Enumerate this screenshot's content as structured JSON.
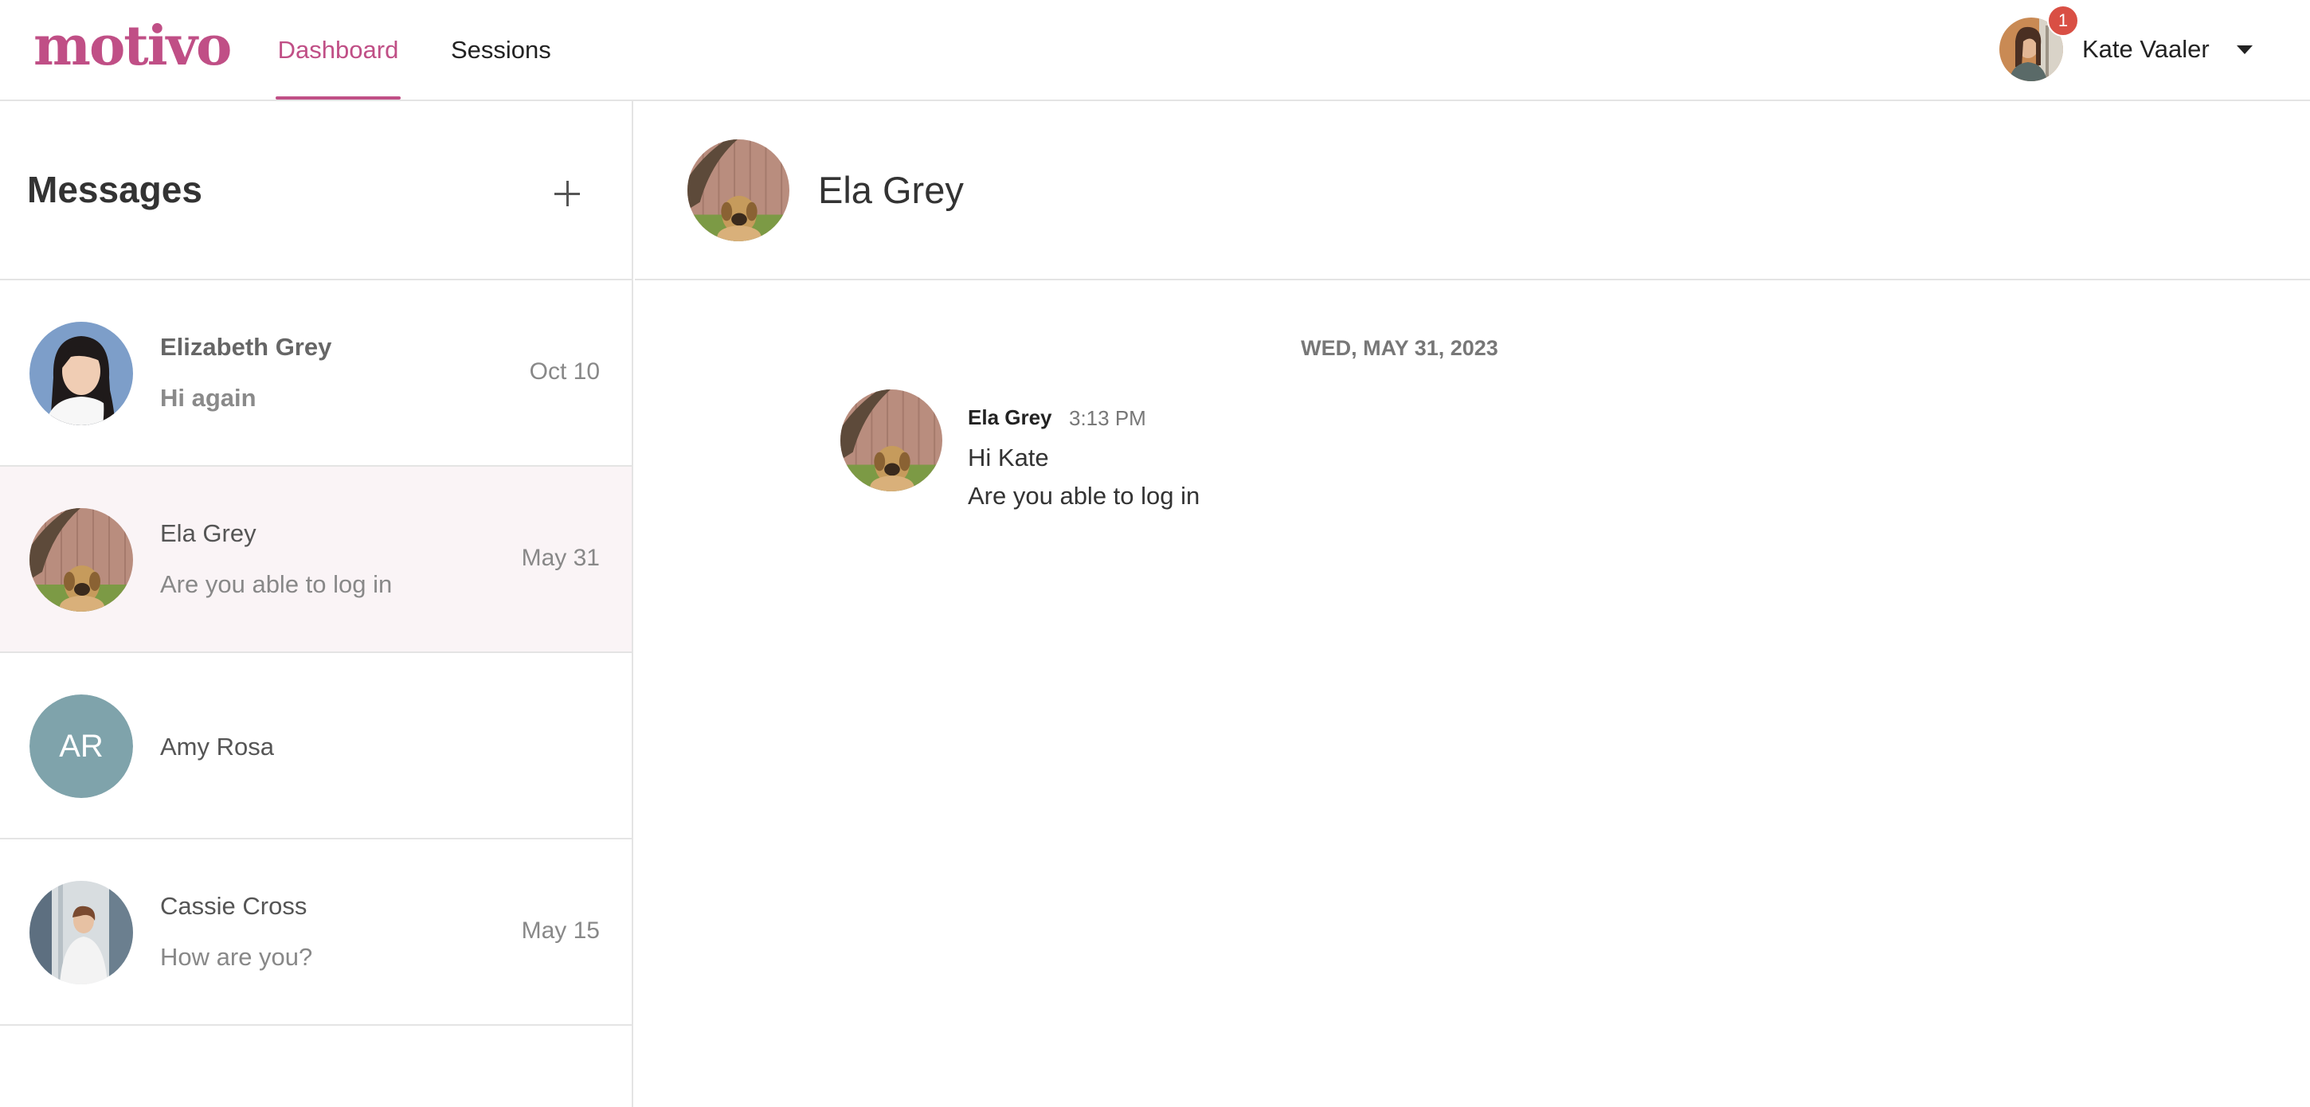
{
  "header": {
    "logo": "motivo",
    "nav": [
      {
        "label": "Dashboard",
        "active": true
      },
      {
        "label": "Sessions",
        "active": false
      }
    ],
    "user": {
      "name": "Kate Vaaler",
      "notification_count": "1"
    }
  },
  "sidebar": {
    "title": "Messages",
    "conversations": [
      {
        "name": "Elizabeth Grey",
        "preview": "Hi again",
        "date": "Oct 10",
        "unread": true,
        "avatar": "photo-woman"
      },
      {
        "name": "Ela Grey",
        "preview": "Are you able to log in",
        "date": "May 31",
        "selected": true,
        "avatar": "photo-dog"
      },
      {
        "name": "Amy Rosa",
        "initials": "AR",
        "avatar": "initials"
      },
      {
        "name": "Cassie Cross",
        "preview": "How are you?",
        "date": "May 15",
        "avatar": "photo-woman-office"
      }
    ]
  },
  "main": {
    "title": "Ela Grey",
    "day_divider": "WED, MAY 31, 2023",
    "message": {
      "author": "Ela Grey",
      "time": "3:13 PM",
      "lines": [
        "Hi Kate",
        "Are you able to log in"
      ]
    }
  },
  "colors": {
    "brand": "#c04f86",
    "badge": "#d94f44",
    "initials_bg": "#7fa3ab",
    "selected_row": "#faf4f6"
  }
}
